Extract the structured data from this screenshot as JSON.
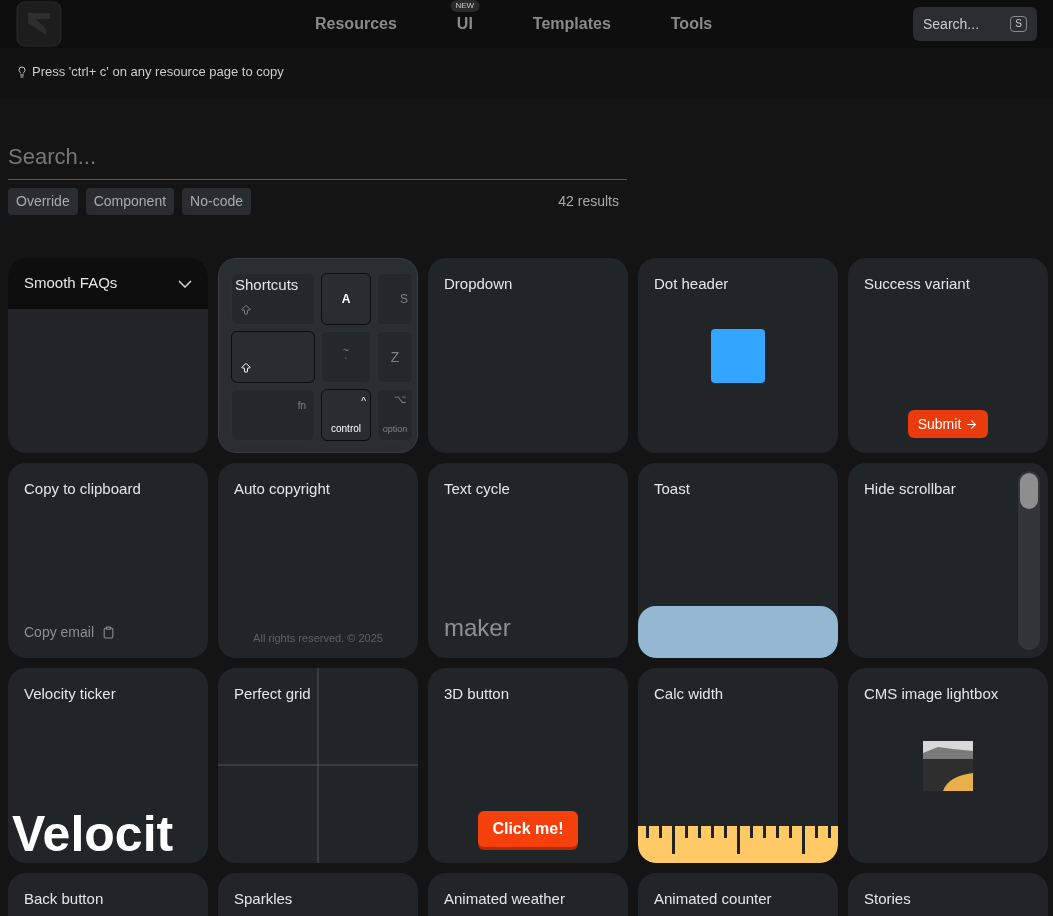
{
  "nav": {
    "links": [
      {
        "label": "Resources"
      },
      {
        "label": "UI",
        "badge": "NEW"
      },
      {
        "label": "Templates"
      },
      {
        "label": "Tools"
      }
    ],
    "search": {
      "placeholder": "Search...",
      "shortcut": "S"
    }
  },
  "hint": "Press 'ctrl+ c' on any resource page to copy",
  "filter": {
    "placeholder": "Search...",
    "tags": [
      "Override",
      "Component",
      "No-code"
    ],
    "count": "42 results"
  },
  "cards": [
    {
      "title": "Smooth FAQs",
      "kind": "faq"
    },
    {
      "title": "Shortcuts",
      "kind": "shortcuts",
      "keys": {
        "a": "A",
        "s": "S",
        "tilde": "~",
        "backtick": "`",
        "z": "Z",
        "fn": "fn",
        "control": "control",
        "caret": "^",
        "option": "option",
        "opt": "⌥"
      }
    },
    {
      "title": "Dropdown",
      "kind": "plain"
    },
    {
      "title": "Dot header",
      "kind": "dot"
    },
    {
      "title": "Success variant",
      "kind": "submit",
      "text": "Submit"
    },
    {
      "title": "Copy to clipboard",
      "kind": "clipboard",
      "text": "Copy email"
    },
    {
      "title": "Auto copyright",
      "kind": "copyright",
      "text": "All rights reserved. © 2025"
    },
    {
      "title": "Text cycle",
      "kind": "textcycle",
      "text": "maker"
    },
    {
      "title": "Toast",
      "kind": "toast"
    },
    {
      "title": "Hide scrollbar",
      "kind": "scrollbar"
    },
    {
      "title": "Velocity ticker",
      "kind": "velocity",
      "text": "Velocit"
    },
    {
      "title": "Perfect grid",
      "kind": "grid"
    },
    {
      "title": "3D button",
      "kind": "button3d",
      "text": "Click me!"
    },
    {
      "title": "Calc width",
      "kind": "ruler"
    },
    {
      "title": "CMS image lightbox",
      "kind": "lightbox"
    },
    {
      "title": "Back button",
      "kind": "plain"
    },
    {
      "title": "Sparkles",
      "kind": "plain"
    },
    {
      "title": "Animated weather",
      "kind": "plain"
    },
    {
      "title": "Animated counter",
      "kind": "plain"
    },
    {
      "title": "Stories",
      "kind": "plain"
    }
  ]
}
